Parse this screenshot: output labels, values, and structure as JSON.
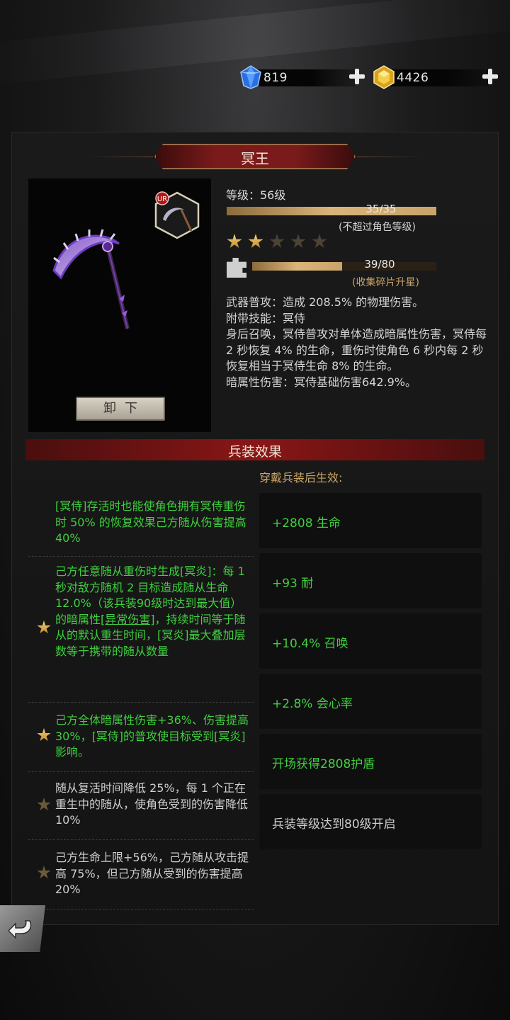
{
  "currency": {
    "gems": {
      "value": "819",
      "icon": "blue-gem-icon"
    },
    "gold": {
      "value": "4426",
      "icon": "gold-gem-icon"
    }
  },
  "weapon": {
    "name": "冥王",
    "rarity": "UR",
    "unequip_label": "卸下",
    "level_label": "等级：56级",
    "exp_bar": {
      "text": "35/35",
      "fraction": 1.0,
      "note": "(不超过角色等级)"
    },
    "stars": {
      "filled": 2,
      "total": 5
    },
    "shard_bar": {
      "text": "39/80",
      "fraction": 0.4875,
      "note": "(收集碎片升星)"
    },
    "description": [
      "武器普攻：造成 208.5% 的物理伤害。",
      "附带技能：冥侍",
      "身后召唤，冥侍普攻对单体造成暗属性伤害，冥侍每 2 秒恢复 4% 的生命，重伤时使角色 6 秒内每 2 秒恢复相当于冥侍生命 8% 的生命。",
      "暗属性伤害：冥侍基础伤害642.9%。"
    ]
  },
  "effects": {
    "title": "兵装效果",
    "subtitle": "穿戴兵装后生效:",
    "skills": [
      {
        "text": "[冥侍]存活时也能使角色拥有冥侍重伤时 50% 的恢复效果己方随从伤害提高 40%",
        "active": true,
        "star": "none"
      },
      {
        "text_a": "己方任意随从重伤时生成[冥炎]：每 1 秒对敌方随机 2 目标造成随从生命 12.0%（该兵装90级时达到最大值） 的暗属性",
        "link": "[异常伤害]",
        "text_b": "，持续时间等于随从的默认重生时间，[冥炎]最大叠加层数等于携带的随从数量",
        "active": true,
        "star": "gold"
      },
      {
        "text": "己方全体暗属性伤害+36%、伤害提高 30%，[冥侍]的普攻使目标受到[冥炎]影响。",
        "active": true,
        "star": "gold"
      },
      {
        "text": "随从复活时间降低 25%，每 1 个正在重生中的随从，使角色受到的伤害降低 10%",
        "active": false,
        "star": "dim"
      },
      {
        "text": "己方生命上限+56%，己方随从攻击提高 75%，但己方随从受到的伤害提高 20%",
        "active": false,
        "star": "dim"
      }
    ],
    "stats": [
      {
        "text": "+2808 生命",
        "active": true
      },
      {
        "text": "+93 耐",
        "active": true
      },
      {
        "text": "+10.4% 召唤",
        "active": true
      },
      {
        "text": "+2.8% 会心率",
        "active": true
      },
      {
        "text": "开场获得2808护盾",
        "active": true
      },
      {
        "text": "兵装等级达到80级开启",
        "active": false
      }
    ]
  },
  "back_icon": "back-arrow-icon"
}
